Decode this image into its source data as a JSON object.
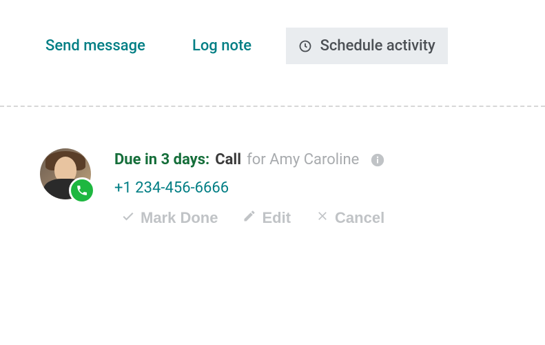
{
  "tabs": {
    "send_message": "Send message",
    "log_note": "Log note",
    "schedule_activity": "Schedule activity"
  },
  "activity": {
    "due_label": "Due in 3 days:",
    "type": "Call",
    "for_text": "for Amy Caroline",
    "phone": "+1 234-456-6666"
  },
  "actions": {
    "mark_done": "Mark Done",
    "edit": "Edit",
    "cancel": "Cancel"
  }
}
